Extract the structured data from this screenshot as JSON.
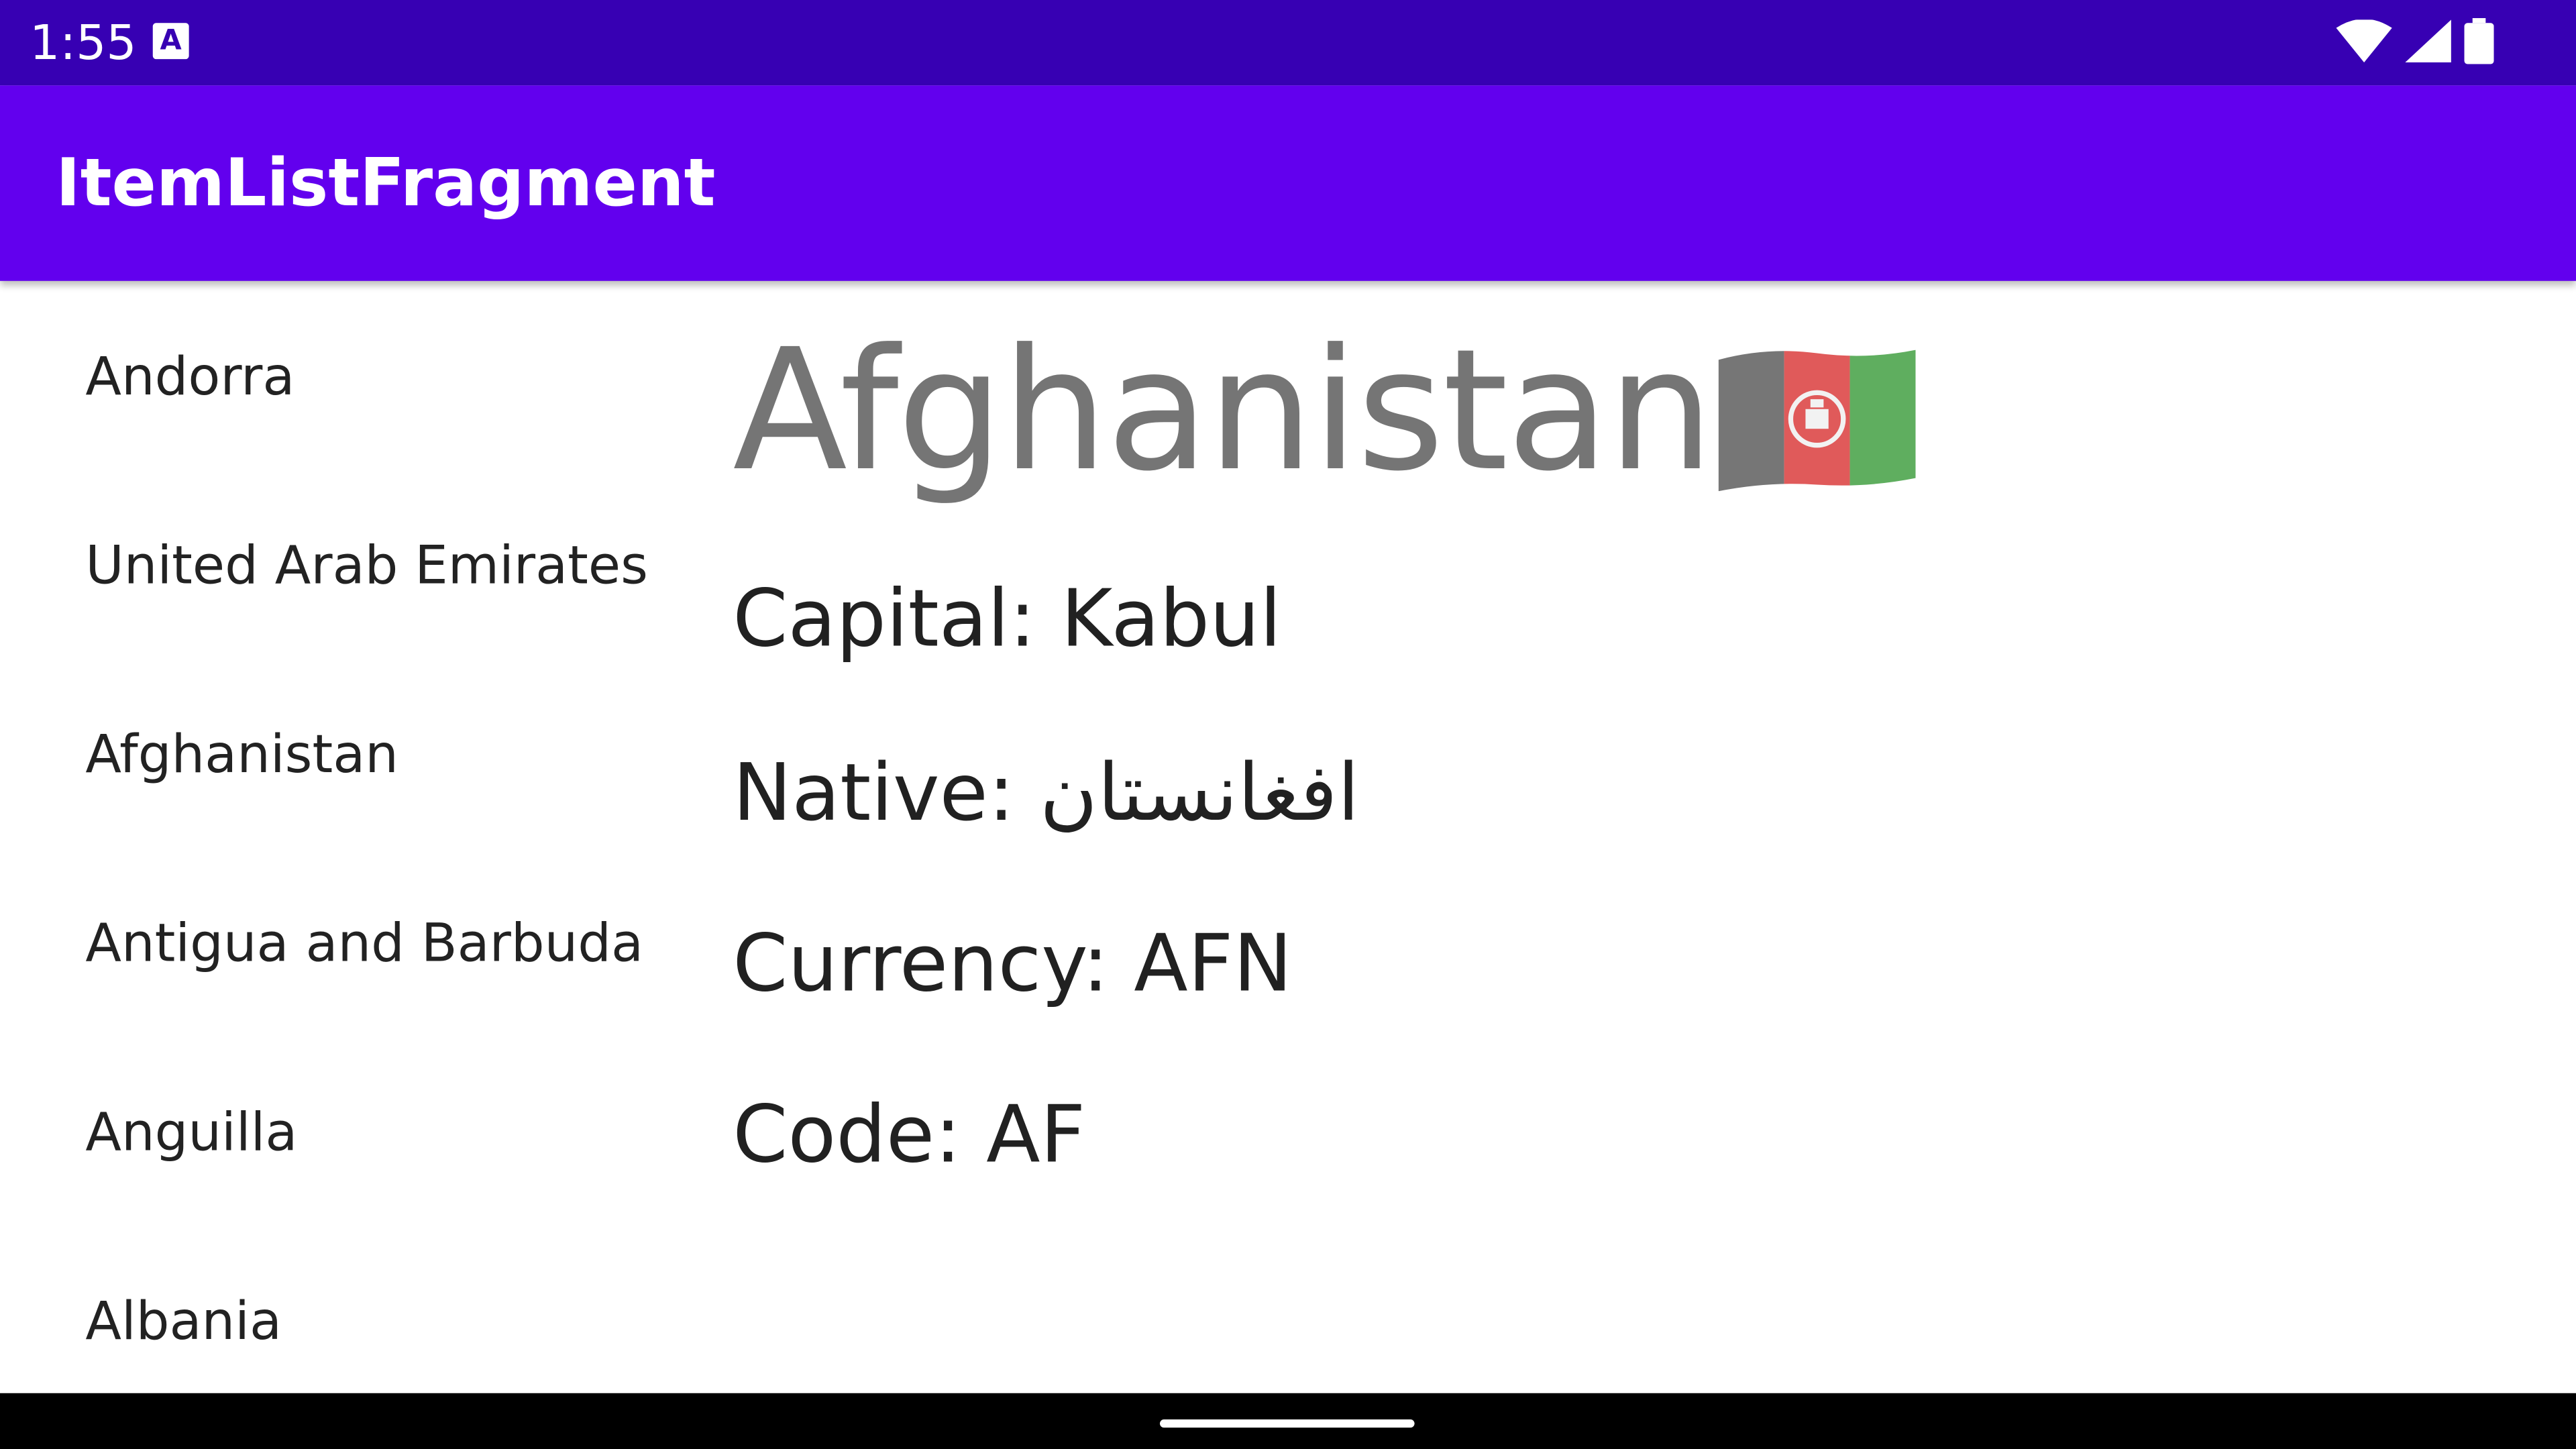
{
  "status_bar": {
    "time": "1:55",
    "notification_icon": "a-letter-icon",
    "icons": [
      "wifi-icon",
      "cellular-signal-icon",
      "battery-icon"
    ]
  },
  "app_bar": {
    "title": "ItemListFragment"
  },
  "country_list": {
    "items": [
      {
        "label": "Andorra"
      },
      {
        "label": "United Arab Emirates"
      },
      {
        "label": "Afghanistan"
      },
      {
        "label": "Antigua and Barbuda"
      },
      {
        "label": "Anguilla"
      },
      {
        "label": "Albania"
      }
    ]
  },
  "detail": {
    "name": "Afghanistan",
    "flag_icon": "afghanistan-flag-icon",
    "capital_label": "Capital: ",
    "capital": "Kabul",
    "native_label": "Native: ",
    "native": "افغانستان",
    "currency_label": "Currency: ",
    "currency": "AFN",
    "code_label": "Code: ",
    "code": "AF"
  },
  "colors": {
    "status_bar": "#3700b3",
    "app_bar": "#6200ee",
    "detail_title": "#757575"
  }
}
